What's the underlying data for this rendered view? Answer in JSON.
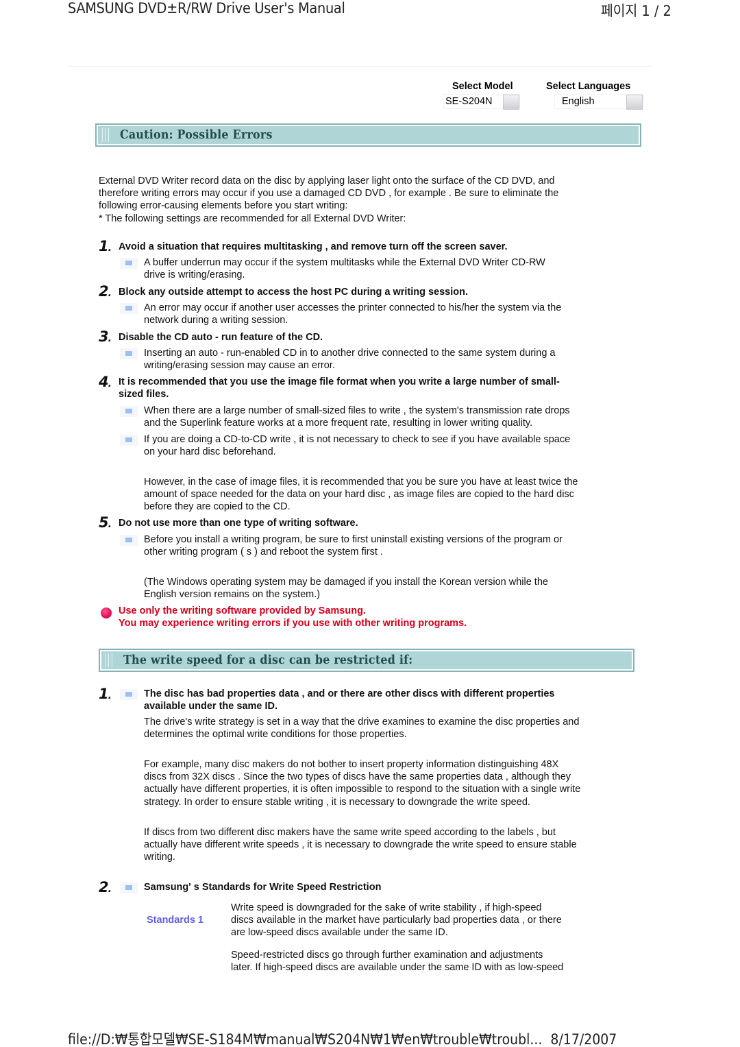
{
  "print_header": {
    "title": "SAMSUNG DVD±R/RW Drive User's Manual",
    "page": "페이지 1 / 2"
  },
  "selectors": {
    "model_label": "Select Model",
    "model_value": "SE-S204N",
    "language_label": "Select Languages",
    "language_value": "English"
  },
  "section1": {
    "title": "Caution: Possible Errors",
    "intro": [
      "External DVD Writer record data on the disc by applying laser light onto the surface of the CD DVD, and",
      "therefore writing errors may occur if you use a damaged CD DVD , for example . Be sure to eliminate the",
      "following error-causing elements before you start writing:",
      "* The following settings are recommended for all External DVD Writer:"
    ],
    "items": [
      {
        "number": "1",
        "heading": "Avoid a situation that requires multitasking , and remove turn off the screen saver.",
        "bullets": [
          [
            "A buffer underrun may occur if the system multitasks while the External DVD Writer CD-RW",
            "drive is writing/erasing."
          ]
        ]
      },
      {
        "number": "2",
        "heading": "Block any outside attempt to access the host PC during a writing session.",
        "bullets": [
          [
            "An error may occur if another user accesses the printer connected to his/her the system via the",
            "network during a writing session."
          ]
        ]
      },
      {
        "number": "3",
        "heading": "Disable the CD auto - run feature of the CD.",
        "bullets": [
          [
            "Inserting an auto - run-enabled CD in to another drive connected to the same system during a",
            "writing/erasing session may cause an error."
          ]
        ]
      },
      {
        "number": "4",
        "heading": [
          "It is recommended that you use the image file format when you write a large number of small-",
          "sized files."
        ],
        "bullets": [
          [
            "When there are a large number of small-sized files to write , the system's transmission rate drops",
            "and the Superlink feature works at a more frequent rate, resulting in lower writing quality."
          ],
          [
            "If you are doing a CD-to-CD write , it is not necessary to check to see if you have available space",
            "on your hard disc beforehand."
          ]
        ],
        "note": [
          "However, in the case of image files, it is recommended that you be sure you have at least twice the",
          "amount of space needed for the data on your hard disc , as image files are copied to the hard disc",
          "before they are copied to the CD."
        ]
      },
      {
        "number": "5",
        "heading": "Do not use more than one type of writing software.",
        "bullets": [
          [
            "Before you install a writing program, be sure to first uninstall existing versions of the program or",
            "other writing program ( s ) and reboot the system first ."
          ]
        ],
        "note": [
          "(The Windows operating system may be damaged if you install the Korean version while the",
          "English version remains on the system.)"
        ]
      }
    ],
    "warning": [
      "Use only the writing software provided by Samsung.",
      "You may experience writing errors if you use with other writing programs."
    ]
  },
  "section2": {
    "title": "The write speed for a disc can be restricted if:",
    "items": [
      {
        "number": "1",
        "heading": [
          "The disc has bad properties data , and or there are other discs with different properties",
          "available under the same ID."
        ],
        "paragraphs": [
          [
            "The drive's write strategy is set in a way that the drive examines to examine the disc properties and",
            "determines the optimal write conditions for those properties."
          ],
          [
            "For example, many disc makers do not bother to insert property information distinguishing 48X",
            "discs from 32X discs . Since the two types of discs have the same properties data , although they",
            "actually have different properties, it is often impossible to respond to the situation with a single write",
            "strategy. In order to ensure stable writing , it is necessary to downgrade the write speed."
          ],
          [
            "If discs from two different disc makers have the same write speed according to the labels , but",
            "actually have different write speeds , it is necessary to downgrade the write speed to ensure stable",
            "writing."
          ]
        ]
      },
      {
        "number": "2",
        "heading": "Samsung' s Standards for Write Speed Restriction",
        "standards_label": "Standards 1",
        "paragraphs": [
          [
            "Write speed is downgraded for the sake of write stability , if high-speed",
            "discs available in the market have particularly bad properties data , or there",
            "are low-speed discs available under the same ID."
          ],
          [
            "Speed-restricted discs go through further examination and adjustments",
            "later. If high-speed discs are available under the same ID with as low-speed"
          ]
        ]
      }
    ]
  },
  "print_footer": {
    "path": "file://D:₩통합모델₩SE-S184M₩manual₩S204N₩1₩en₩trouble₩troubl...",
    "date": "8/17/2007"
  },
  "colors": {
    "section_bar_fill": "#b0d5d7",
    "section_bar_border": "#7fb5b7",
    "section_title": "#1e4b4c",
    "warning_red": "#d4001a",
    "standards_blue": "#5f5fe6",
    "bullet_blue": "#9dc0ee"
  }
}
